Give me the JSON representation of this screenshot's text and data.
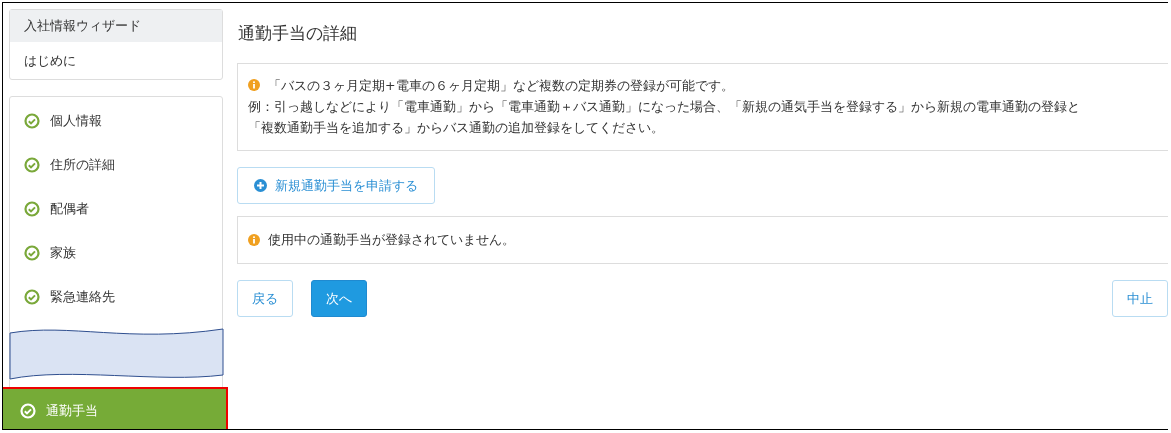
{
  "sidebar": {
    "header": "入社情報ウィザード",
    "intro": "はじめに",
    "steps": [
      {
        "kind": "step",
        "label": "個人情報",
        "completed": true,
        "selected": false
      },
      {
        "kind": "step",
        "label": "住所の詳細",
        "completed": true,
        "selected": false
      },
      {
        "kind": "step",
        "label": "配偶者",
        "completed": true,
        "selected": false
      },
      {
        "kind": "step",
        "label": "家族",
        "completed": true,
        "selected": false
      },
      {
        "kind": "step",
        "label": "緊急連絡先",
        "completed": true,
        "selected": false
      },
      {
        "kind": "break"
      },
      {
        "kind": "step",
        "label": "通勤手当",
        "completed": true,
        "selected": true
      }
    ]
  },
  "main": {
    "title": "通勤手当の詳細",
    "notice": {
      "lines": [
        "「バスの３ヶ月定期+電車の６ヶ月定期」など複数の定期券の登録が可能です。",
        "例：引っ越しなどにより「電車通勤」から「電車通勤＋バス通勤」になった場合、「新規の通気手当を登録する」から新規の電車通勤の登録と",
        "「複数通勤手当を追加する」からバス通勤の追加登録をしてください。"
      ]
    },
    "add_button": {
      "label": "新規通勤手当を申請する"
    },
    "empty_notice": {
      "text": "使用中の通勤手当が登録されていません。"
    },
    "buttons": [
      {
        "kind": "back",
        "label": "戻る"
      },
      {
        "kind": "primary",
        "label": "次へ"
      },
      {
        "kind": "cancel",
        "label": "中止"
      }
    ]
  }
}
